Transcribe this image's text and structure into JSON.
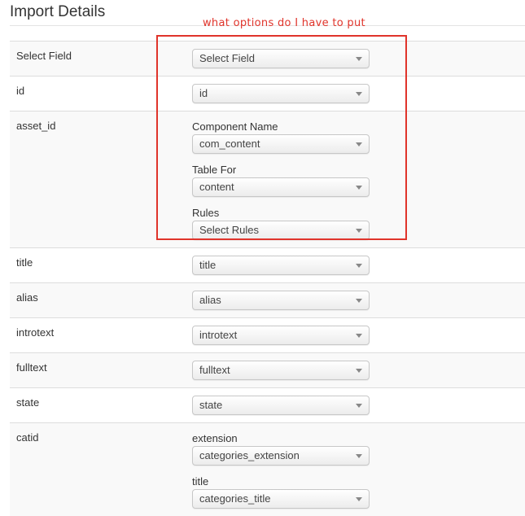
{
  "page": {
    "title": "Import Details",
    "annotation": "what options do I have to put"
  },
  "rows": [
    {
      "label": "Select Field",
      "controls": [
        {
          "sub_label": "",
          "value": "Select Field"
        }
      ]
    },
    {
      "label": "id",
      "controls": [
        {
          "sub_label": "",
          "value": "id"
        }
      ]
    },
    {
      "label": "asset_id",
      "controls": [
        {
          "sub_label": "Component Name",
          "value": "com_content"
        },
        {
          "sub_label": "Table For",
          "value": "content"
        },
        {
          "sub_label": "Rules",
          "value": "Select Rules"
        }
      ]
    },
    {
      "label": "title",
      "controls": [
        {
          "sub_label": "",
          "value": "title"
        }
      ]
    },
    {
      "label": "alias",
      "controls": [
        {
          "sub_label": "",
          "value": "alias"
        }
      ]
    },
    {
      "label": "introtext",
      "controls": [
        {
          "sub_label": "",
          "value": "introtext"
        }
      ]
    },
    {
      "label": "fulltext",
      "controls": [
        {
          "sub_label": "",
          "value": "fulltext"
        }
      ]
    },
    {
      "label": "state",
      "controls": [
        {
          "sub_label": "",
          "value": "state"
        }
      ]
    },
    {
      "label": "catid",
      "controls": [
        {
          "sub_label": "extension",
          "value": "categories_extension"
        },
        {
          "sub_label": "title",
          "value": "categories_title"
        }
      ]
    }
  ],
  "colors": {
    "annotation": "#e0342b",
    "row_stripe": "#f9f9f9",
    "row_border": "#dddddd"
  },
  "icons": {
    "select_caret": "chevron-down-icon"
  }
}
